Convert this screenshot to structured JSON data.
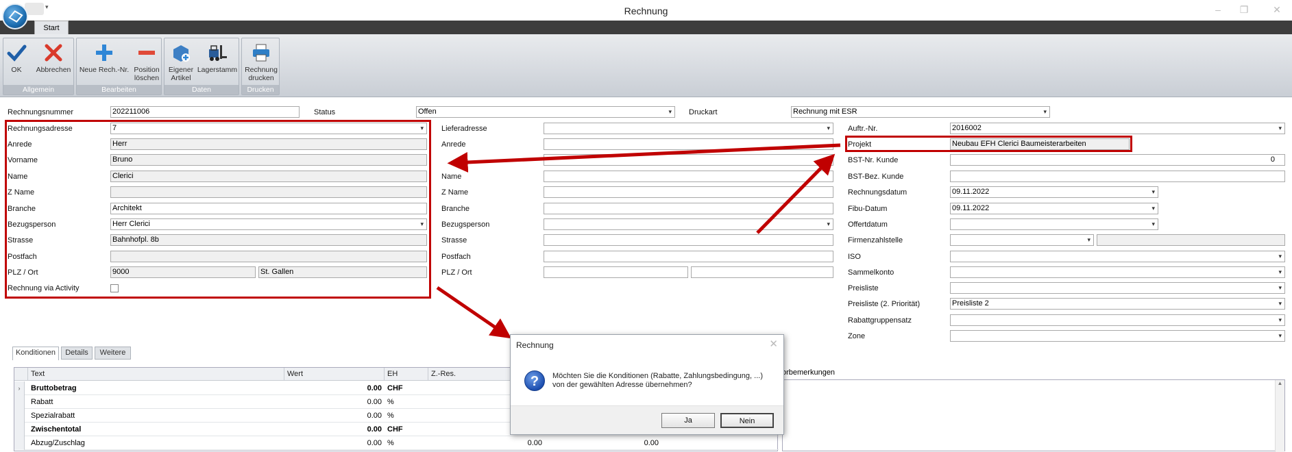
{
  "window": {
    "title": "Rechnung",
    "minimize": "–",
    "restore": "❐",
    "close": "✕"
  },
  "quick_access_arrow": "▾",
  "ribbon": {
    "tab": "Start",
    "groups": [
      {
        "label": "Allgemein",
        "buttons": [
          {
            "label": "OK",
            "icon": "checkmark-icon"
          },
          {
            "label": "Abbrechen",
            "icon": "cross-icon"
          }
        ]
      },
      {
        "label": "Bearbeiten",
        "buttons": [
          {
            "label": "Neue Rech.-Nr.",
            "icon": "plus-icon"
          },
          {
            "label_line1": "Position",
            "label_line2": "löschen",
            "icon": "minus-icon"
          }
        ]
      },
      {
        "label": "Daten",
        "buttons": [
          {
            "label_line1": "Eigener",
            "label_line2": "Artikel",
            "icon": "add-article-icon"
          },
          {
            "label": "Lagerstamm",
            "icon": "forklift-icon"
          }
        ]
      },
      {
        "label": "Drucken",
        "buttons": [
          {
            "label_line1": "Rechnung",
            "label_line2": "drucken",
            "icon": "printer-icon"
          }
        ]
      }
    ]
  },
  "header": {
    "rechnungsnummer_label": "Rechnungsnummer",
    "rechnungsnummer": "202211006",
    "status_label": "Status",
    "status": "Offen",
    "druckart_label": "Druckart",
    "druckart": "Rechnung mit ESR"
  },
  "rechnungsadresse": {
    "adresse_label": "Rechnungsadresse",
    "adresse": "7",
    "anrede_label": "Anrede",
    "anrede": "Herr",
    "vorname_label": "Vorname",
    "vorname": "Bruno",
    "name_label": "Name",
    "name": "Clerici",
    "zname_label": "Z Name",
    "zname": "",
    "branche_label": "Branche",
    "branche": "Architekt",
    "bezugsperson_label": "Bezugsperson",
    "bezugsperson": "Herr Clerici",
    "strasse_label": "Strasse",
    "strasse": "Bahnhofpl. 8b",
    "postfach_label": "Postfach",
    "postfach": "",
    "plz_label": "PLZ / Ort",
    "plz": "9000",
    "ort": "St. Gallen",
    "activity_label": "Rechnung via Activity"
  },
  "lieferadresse": {
    "adresse_label": "Lieferadresse",
    "anrede_label": "Anrede",
    "name_label": "Name",
    "zname_label": "Z Name",
    "branche_label": "Branche",
    "bezugsperson_label": "Bezugsperson",
    "strasse_label": "Strasse",
    "postfach_label": "Postfach",
    "plz_label": "PLZ / Ort"
  },
  "auftrag": {
    "auftr_label": "Auftr.-Nr.",
    "auftr": "2016002",
    "projekt_label": "Projekt",
    "projekt": "Neubau EFH Clerici Baumeisterarbeiten",
    "bst_nr_label": "BST-Nr. Kunde",
    "bst_nr": "0",
    "bst_bez_label": "BST-Bez. Kunde",
    "rechnungsdatum_label": "Rechnungsdatum",
    "rechnungsdatum": "09.11.2022",
    "fibu_label": "Fibu-Datum",
    "fibu": "09.11.2022",
    "offertdatum_label": "Offertdatum",
    "firmenzahlstelle_label": "Firmenzahlstelle",
    "iso_label": "ISO",
    "sammelkonto_label": "Sammelkonto",
    "preisliste_label": "Preisliste",
    "preisliste2_label": "Preisliste (2. Priorität)",
    "preisliste2": "Preisliste 2",
    "rabattgruppensatz_label": "Rabattgruppensatz",
    "zone_label": "Zone"
  },
  "bottom_tabs": [
    "Konditionen",
    "Details",
    "Weitere"
  ],
  "grid": {
    "columns": [
      "Text",
      "Wert",
      "EH",
      "Z.-Res."
    ],
    "rows": [
      {
        "text": "Bruttobetrag",
        "wert": "0.00",
        "eh": "CHF",
        "bold": true,
        "a": "",
        "b": ""
      },
      {
        "text": "Rabatt",
        "wert": "0.00",
        "eh": "%",
        "bold": false,
        "a": "",
        "b": ""
      },
      {
        "text": "Spezialrabatt",
        "wert": "0.00",
        "eh": "%",
        "bold": false,
        "a": "",
        "b": ""
      },
      {
        "text": "Zwischentotal",
        "wert": "0.00",
        "eh": "CHF",
        "bold": true,
        "a": "",
        "b": ""
      },
      {
        "text": "Abzug/Zuschlag",
        "wert": "0.00",
        "eh": "%",
        "bold": false,
        "a": "0.00",
        "b": "0.00"
      }
    ]
  },
  "remarks_label": "orbemerkungen",
  "dialog": {
    "title": "Rechnung",
    "close": "✕",
    "icon": "?",
    "message": "Möchten Sie die Konditionen (Rabatte, Zahlungsbedingung, ...) von der gewählten Adresse übernehmen?",
    "yes": "Ja",
    "no": "Nein"
  },
  "annotation_color": "#c00000"
}
